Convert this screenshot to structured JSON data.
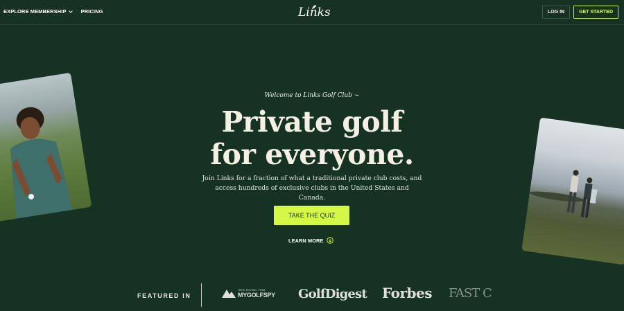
{
  "nav": {
    "explore_label": "EXPLORE MEMBERSHIP",
    "pricing_label": "PRICING",
    "logo_text": "Links",
    "login_label": "LOG IN",
    "get_started_label": "GET STARTED"
  },
  "hero": {
    "kicker": "Welcome to Links Golf Club ~",
    "headline_line1": "Private golf",
    "headline_line2": "for everyone.",
    "subtext": "Join Links for a fraction of what a traditional private club costs, and access hundreds of exclusive clubs in the United States and Canada.",
    "quiz_button": "TAKE THE QUIZ",
    "learn_more": "LEARN MORE"
  },
  "featured": {
    "label": "FEATURED IN",
    "logos": {
      "mygolfspy_tagline": "100% TESTED. TRUE",
      "mygolfspy": "MYGOLFSPY",
      "golfdigest": "GolfDigest",
      "forbes": "Forbes",
      "fastcompany": "FAST C"
    }
  },
  "colors": {
    "background": "#163223",
    "accent": "#d3f845",
    "text_light": "#f4f1e4"
  }
}
